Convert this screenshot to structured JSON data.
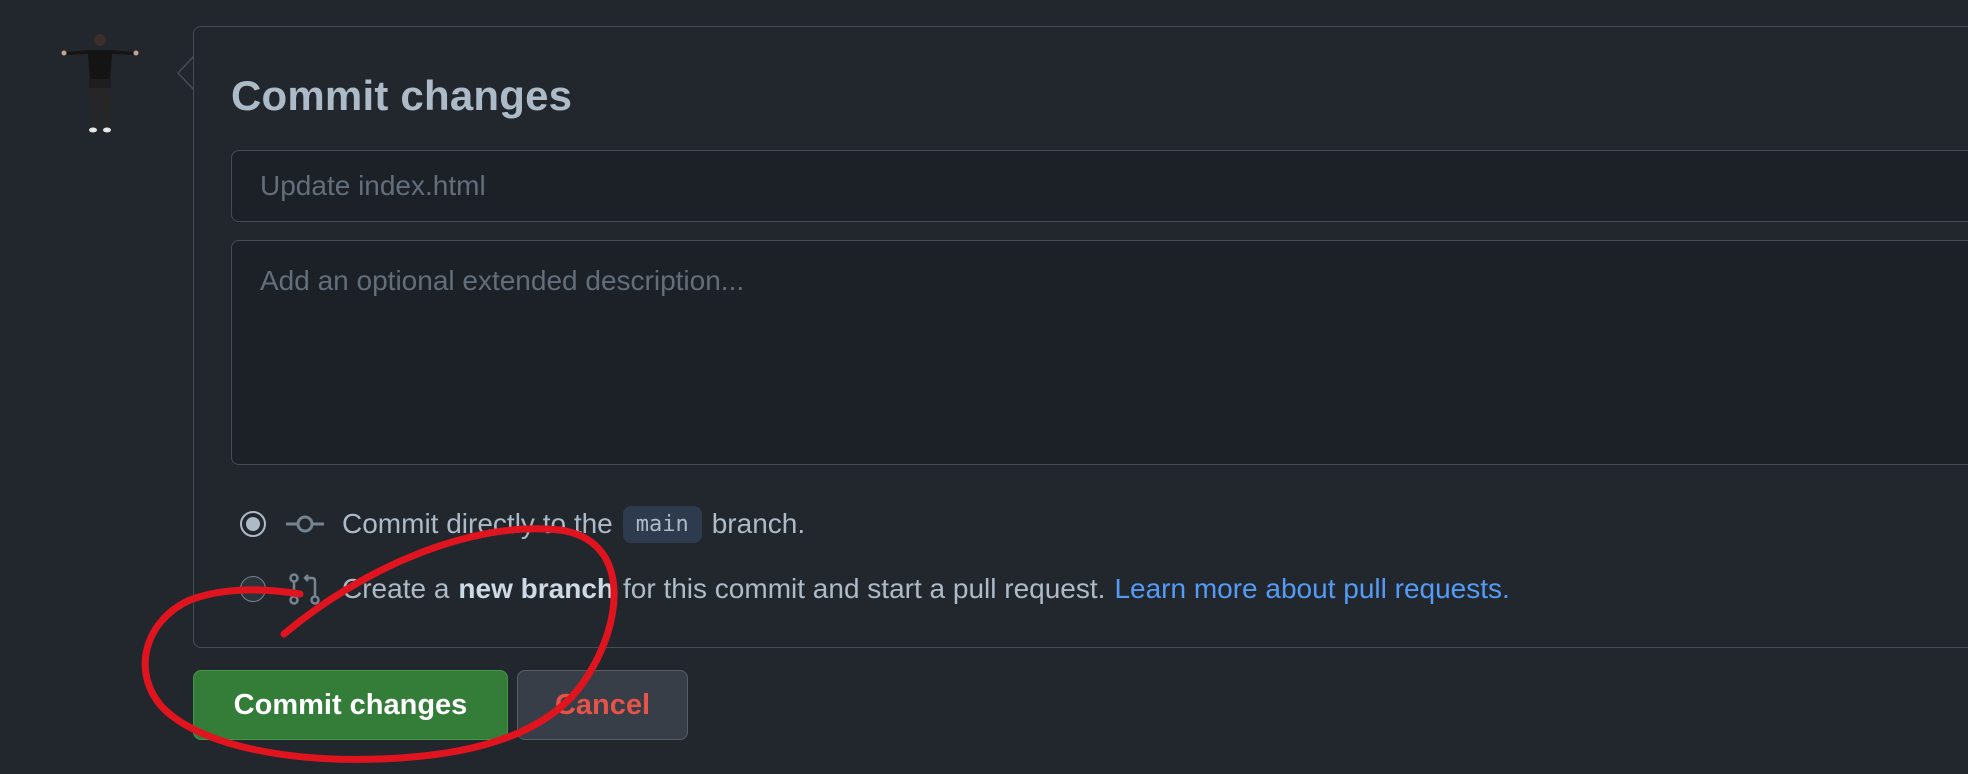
{
  "form": {
    "title": "Commit changes",
    "summary_placeholder": "Update index.html",
    "description_placeholder": "Add an optional extended description..."
  },
  "options": [
    {
      "selected": true,
      "icon": "git-commit-icon",
      "text_before": "Commit directly to the",
      "branch": "main",
      "text_after": "branch."
    },
    {
      "selected": false,
      "icon": "git-pull-request-icon",
      "text_before": "Create a",
      "bold": "new branch",
      "text_after": "for this commit and start a pull request.",
      "link": "Learn more about pull requests."
    }
  ],
  "buttons": {
    "commit": "Commit changes",
    "cancel": "Cancel"
  },
  "colors": {
    "background": "#22272e",
    "commit_button": "#347d39",
    "cancel_text": "#e5534b",
    "link": "#539bf5",
    "annotation": "#e0141e"
  }
}
